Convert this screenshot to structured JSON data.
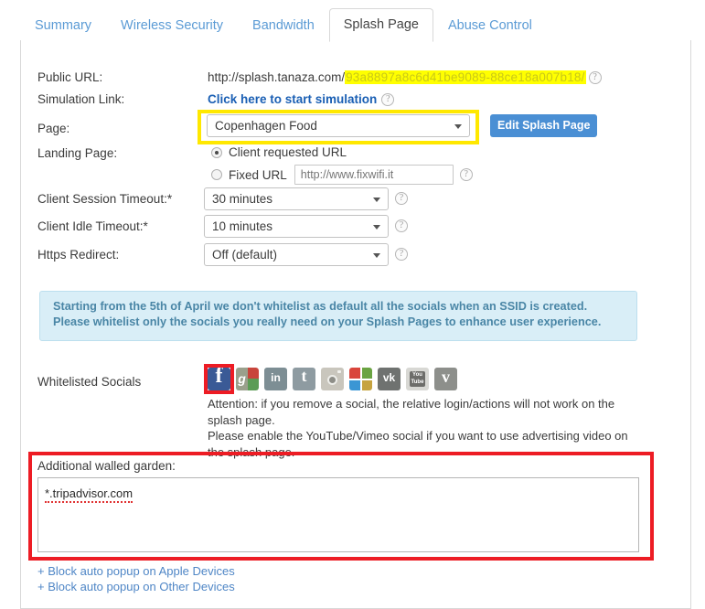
{
  "tabs": [
    {
      "label": "Summary",
      "active": false
    },
    {
      "label": "Wireless Security",
      "active": false
    },
    {
      "label": "Bandwidth",
      "active": false
    },
    {
      "label": "Splash Page",
      "active": true
    },
    {
      "label": "Abuse Control",
      "active": false
    }
  ],
  "form": {
    "public_url_label": "Public URL:",
    "public_url_prefix": "http://splash.tanaza.com/",
    "public_url_redacted": "93a8897a8c6d41be9089-88ce18a007b18/",
    "simulation_label": "Simulation Link:",
    "simulation_link": "Click here to start simulation",
    "page_label": "Page:",
    "page_value": "Copenhagen Food",
    "edit_splash_button": "Edit Splash Page",
    "landing_label": "Landing Page:",
    "radio_client_label": "Client requested URL",
    "radio_fixed_label": "Fixed URL",
    "fixed_url_value": "",
    "fixed_url_placeholder": "http://www.fixwifi.it",
    "session_timeout_label": "Client Session Timeout:*",
    "session_timeout_value": "30 minutes",
    "idle_timeout_label": "Client Idle Timeout:*",
    "idle_timeout_value": "10 minutes",
    "https_redirect_label": "Https Redirect:",
    "https_redirect_value": "Off (default)"
  },
  "notice": {
    "line1": "Starting from the 5th of April we don't whitelist as default all the socials when an SSID is created.",
    "line2": "Please whitelist only the socials you really need on your Splash Pages to enhance user experience."
  },
  "socials": {
    "label": "Whitelisted Socials",
    "items": [
      {
        "name": "facebook-icon",
        "title": "Facebook",
        "highlighted": true
      },
      {
        "name": "google-plus-icon",
        "title": "Google Plus",
        "highlighted": false
      },
      {
        "name": "linkedin-icon",
        "title": "LinkedIn",
        "highlighted": false
      },
      {
        "name": "twitter-icon",
        "title": "Twitter",
        "highlighted": false
      },
      {
        "name": "instagram-icon",
        "title": "Instagram",
        "highlighted": false
      },
      {
        "name": "microsoft-icon",
        "title": "Microsoft",
        "highlighted": false
      },
      {
        "name": "vk-icon",
        "title": "VK",
        "highlighted": false
      },
      {
        "name": "youtube-icon",
        "title": "YouTube",
        "highlighted": false
      },
      {
        "name": "vimeo-icon",
        "title": "Vimeo",
        "highlighted": false
      }
    ],
    "attention_line1": "Attention: if you remove a social, the relative login/actions will not work on the",
    "attention_line2": "splash page.",
    "attention_line3": "Please enable the YouTube/Vimeo social if you want to use advertising video on",
    "attention_line4": "the splash page."
  },
  "walled_garden": {
    "label": "Additional walled garden:",
    "value": "*.tripadvisor.com"
  },
  "bottom_links": [
    {
      "label": "+ Block auto popup on Apple Devices"
    },
    {
      "label": "+ Block auto popup on Other Devices"
    }
  ],
  "icons": {
    "help": "?"
  },
  "colors": {
    "accent_blue": "#4a8fd4",
    "link_blue": "#5b9bd5",
    "highlight_yellow": "#ffe800",
    "highlight_red": "#ed1c24",
    "notice_bg": "#d9eef7"
  }
}
